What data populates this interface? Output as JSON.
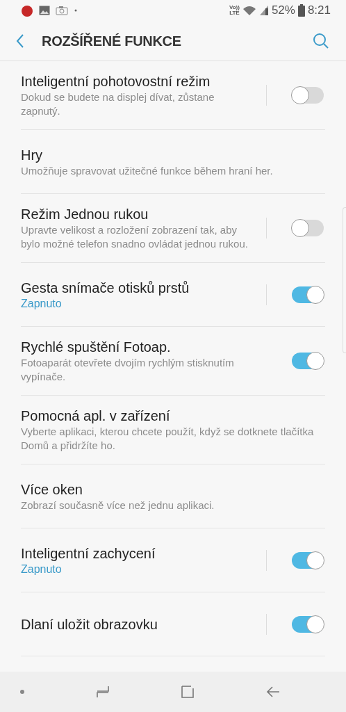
{
  "status_bar": {
    "volte": [
      "Vo))",
      "LTE"
    ],
    "battery": "52%",
    "time": "8:21"
  },
  "header": {
    "title": "ROZŠÍŘENÉ FUNKCE"
  },
  "items": [
    {
      "title": "Inteligentní pohotovostní režim",
      "subtitle": "Dokud se budete na displej dívat, zůstane zapnutý.",
      "kind": "toggle",
      "divider": true,
      "on": false,
      "accent": false
    },
    {
      "title": "Hry",
      "subtitle": "Umožňuje spravovat užitečné funkce během hraní her.",
      "kind": "link"
    },
    {
      "title": "Režim Jednou rukou",
      "subtitle": "Upravte velikost a rozložení zobrazení tak, aby bylo možné telefon snadno ovládat jednou rukou.",
      "kind": "toggle",
      "divider": true,
      "on": false,
      "accent": false
    },
    {
      "title": "Gesta snímače otisků prstů",
      "subtitle": "Zapnuto",
      "kind": "toggle",
      "divider": true,
      "on": true,
      "accent": true
    },
    {
      "title": "Rychlé spuštění Fotoap.",
      "subtitle": "Fotoaparát otevřete dvojím rychlým stisknutím vypínače.",
      "kind": "toggle",
      "divider": false,
      "on": true,
      "accent": false
    },
    {
      "title": "Pomocná apl. v zařízení",
      "subtitle": "Vyberte aplikaci, kterou chcete použít, když se dotknete tlačítka Domů a přidržíte ho.",
      "kind": "link"
    },
    {
      "title": "Více oken",
      "subtitle": "Zobrazí současně více než jednu aplikaci.",
      "kind": "link"
    },
    {
      "title": "Inteligentní zachycení",
      "subtitle": "Zapnuto",
      "kind": "toggle",
      "divider": true,
      "on": true,
      "accent": true
    },
    {
      "title": "Dlaní uložit obrazovku",
      "kind": "toggle",
      "divider": true,
      "on": true
    }
  ]
}
